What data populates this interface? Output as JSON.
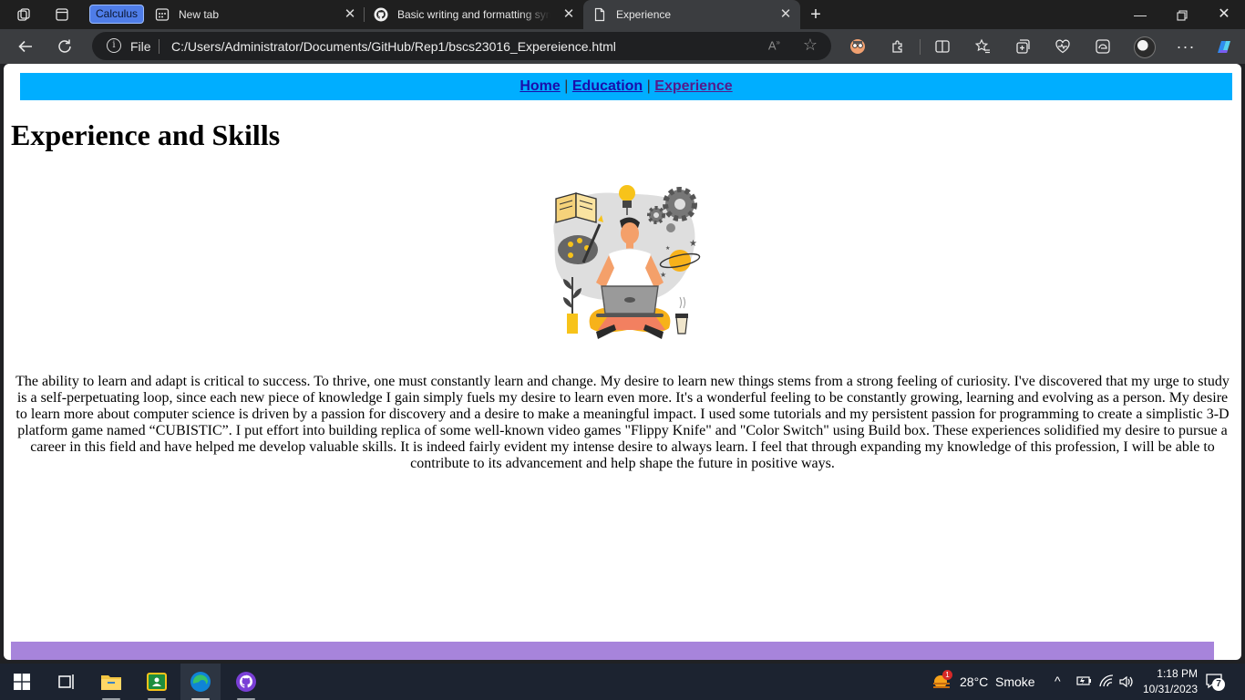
{
  "browser": {
    "group_label": "Calculus",
    "tabs": [
      {
        "title": "New tab"
      },
      {
        "title": "Basic writing and formatting synt"
      },
      {
        "title": "Experience"
      }
    ],
    "address": {
      "scheme_label": "File",
      "url": "C:/Users/Administrator/Documents/GitHub/Rep1/bscs23016_Expereience.html"
    }
  },
  "page": {
    "nav": {
      "home": "Home",
      "education": "Education",
      "experience": "Experience",
      "separator": "|"
    },
    "title": "Experience and Skills",
    "hero_image_icon": "person-with-laptop-illustration",
    "paragraph": "The ability to learn and adapt is critical to success. To thrive, one must constantly learn and change. My desire to learn new things stems from a strong feeling of curiosity. I've discovered that my urge to study is a self-perpetuating loop, since each new piece of knowledge I gain simply fuels my desire to learn even more. It's a wonderful feeling to be constantly growing, learning and evolving as a person. My desire to learn more about computer science is driven by a passion for discovery and a desire to make a meaningful impact. I used some tutorials and my persistent passion for programming to create a simplistic 3-D platform game named “CUBISTIC”. I put effort into building replica of some well-known video games \"Flippy Knife\" and \"Color Switch\" using Build box. These experiences solidified my desire to pursue a career in this field and have helped me develop valuable skills. It is indeed fairly evident my intense desire to always learn. I feel that through expanding my knowledge of this profession, I will be able to contribute to its advancement and help shape the future in positive ways.",
    "colors": {
      "nav_bg": "#00aeff",
      "footer_bg": "#a784db"
    }
  },
  "taskbar": {
    "weather": {
      "temp": "28°C",
      "condition": "Smoke",
      "badge": "1"
    },
    "clock": {
      "time": "1:18 PM",
      "date": "10/31/2023"
    },
    "notifications": "7"
  }
}
